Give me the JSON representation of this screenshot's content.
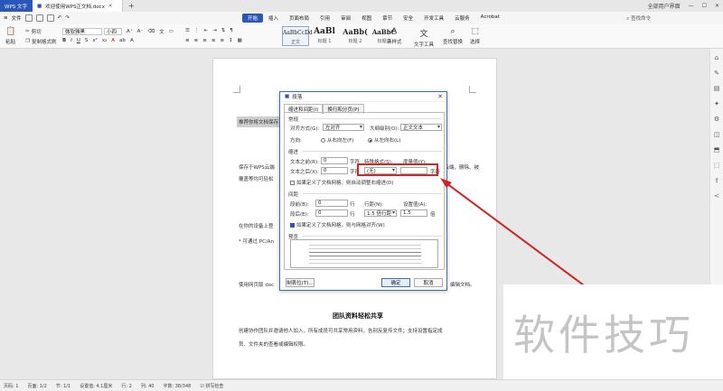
{
  "titlebar": {
    "app_tab": "WPS 文字",
    "doc_tab": "欢迎使用WPS正文档.docx",
    "user": "全部用户界面"
  },
  "menubar": {
    "file": "文件",
    "items": [
      "开始",
      "插入",
      "页面布局",
      "引用",
      "审阅",
      "视图",
      "章节",
      "安全",
      "开发工具",
      "云服务",
      "Acrobat"
    ],
    "active_index": 0,
    "search": "查找命令"
  },
  "ribbon": {
    "paste": "粘贴",
    "cut": "剪切",
    "copy": "复制",
    "format_painter": "格式刷",
    "font": "微软雅黑",
    "size": "小四",
    "styles": [
      {
        "preview": "AaBbCcDd",
        "name": "正文"
      },
      {
        "preview": "AaBl",
        "name": "标题 1"
      },
      {
        "preview": "AaBb(",
        "name": "标题 2"
      },
      {
        "preview": "AaBbC",
        "name": "标题 3"
      }
    ],
    "new_style": "新样式",
    "text_tools": "文字工具",
    "find_replace": "查找替换",
    "select": "选择"
  },
  "page": {
    "line1": "推荐你将文档保存",
    "line2": "保存于WPS云端",
    "line2b": "的云端，删除、被",
    "line3": "覆盖等均可轻松",
    "line4": "在你的设备上登",
    "line5": "* 可通过 PC/An",
    "line6": "使用网页版 doc",
    "line6b": "编辑文档。",
    "heading": "团队资料轻松共享",
    "para1": "创建协作团队并邀请他人加入，所有成员可共享常用资料，告别反复传文件；支持设置指定成",
    "para2": "员、文件夹的查看或编辑权限。"
  },
  "dialog": {
    "title": "段落",
    "tab1": "缩进和间距(I)",
    "tab2": "换行和分页(P)",
    "general": "常规",
    "align_label": "对齐方式(G):",
    "align_value": "左对齐",
    "outline_label": "大纲级别(O):",
    "outline_value": "正文文本",
    "direction_label": "方向:",
    "rtl": "从右向左(F)",
    "ltr": "从左向右(L)",
    "indent": "缩进",
    "before_text": "文本之前(R):",
    "before_value": "0",
    "after_text": "文本之后(X):",
    "after_value": "0",
    "unit_char": "字符",
    "special_label": "特殊格式(S):",
    "special_value": "(无)",
    "measure_label": "度量值(Y):",
    "measure_value": "",
    "grid_indent": "如果定义了文档网格，则自动调整右缩进(D)",
    "spacing": "间距",
    "before_para": "段前(B):",
    "before_para_value": "0",
    "after_para": "段后(E):",
    "after_para_value": "0",
    "unit_line": "行",
    "line_spacing_label": "行距(N):",
    "line_spacing_value": "1.5 倍行距",
    "set_value_label": "设置值(A):",
    "set_value": "1.5",
    "unit_times": "倍",
    "grid_align": "如果定义了文档网格，则与网格对齐(W)",
    "preview": "预览",
    "tabs_button": "制表位(T)...",
    "ok": "确定",
    "cancel": "取消"
  },
  "status": {
    "page_num": "页码: 1",
    "pages": "页面: 1/2",
    "section": "节: 1/1",
    "setting": "设置值: 4.1厘米",
    "row": "行: 2",
    "col": "列: 40",
    "words": "字数: 38/348",
    "spell": "拼写检查"
  },
  "watermark": "软件技巧",
  "colors": {
    "accent": "#2b57b8",
    "highlight": "#d22222"
  }
}
